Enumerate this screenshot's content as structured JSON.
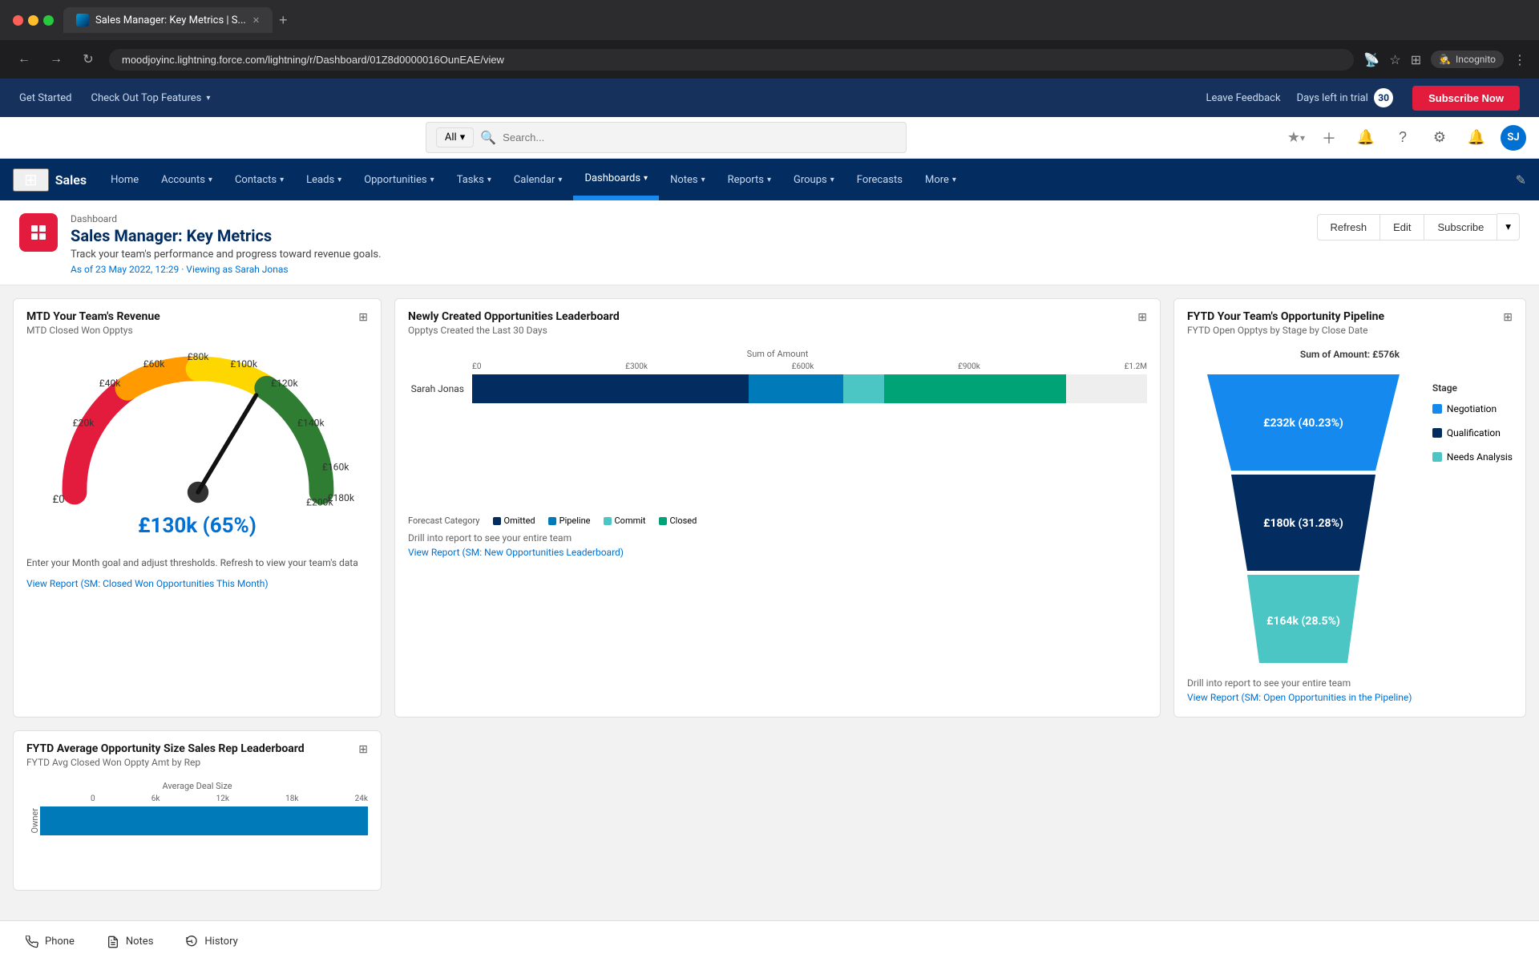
{
  "browser": {
    "tab_title": "Sales Manager: Key Metrics | S...",
    "url": "moodjoyinc.lightning.force.com/lightning/r/Dashboard/01Z8d0000016OunEAE/view",
    "new_tab_label": "+",
    "incognito_label": "Incognito"
  },
  "top_bar": {
    "get_started": "Get Started",
    "check_out_features": "Check Out Top Features",
    "leave_feedback": "Leave Feedback",
    "trial_text": "Days left in trial",
    "trial_days": "30",
    "subscribe_btn": "Subscribe Now"
  },
  "search": {
    "dropdown_label": "All",
    "placeholder": "Search..."
  },
  "sales_nav": {
    "brand": "Sales",
    "items": [
      {
        "label": "Home",
        "active": false
      },
      {
        "label": "Accounts",
        "active": false
      },
      {
        "label": "Contacts",
        "active": false
      },
      {
        "label": "Leads",
        "active": false
      },
      {
        "label": "Opportunities",
        "active": false
      },
      {
        "label": "Tasks",
        "active": false
      },
      {
        "label": "Calendar",
        "active": false
      },
      {
        "label": "Dashboards",
        "active": true
      },
      {
        "label": "Notes",
        "active": false
      },
      {
        "label": "Reports",
        "active": false
      },
      {
        "label": "Groups",
        "active": false
      },
      {
        "label": "Forecasts",
        "active": false
      },
      {
        "label": "More",
        "active": false
      }
    ]
  },
  "dashboard": {
    "breadcrumb": "Dashboard",
    "title": "Sales Manager: Key Metrics",
    "description": "Track your team's performance and progress toward revenue goals.",
    "meta": "As of 23 May 2022, 12:29 · Viewing as Sarah Jonas",
    "refresh_btn": "Refresh",
    "edit_btn": "Edit",
    "subscribe_btn": "Subscribe"
  },
  "card_mtd": {
    "title": "MTD Your Team's Revenue",
    "subtitle": "MTD Closed Won Opptys",
    "value": "£130k (65%)",
    "gauge_labels": [
      "£0",
      "£20k",
      "£40k",
      "£60k",
      "£80k",
      "£100k",
      "£120k",
      "£140k",
      "£160k",
      "£180k",
      "£200k"
    ],
    "enter_month": "Enter your Month goal and adjust thresholds. Refresh to view your team's data",
    "view_report_link": "View Report (SM: Closed Won Opportunities This Month)"
  },
  "card_leaderboard": {
    "title": "Newly Created Opportunities Leaderboard",
    "subtitle": "Opptys Created the Last 30 Days",
    "axis_title": "Sum of Amount",
    "x_labels": [
      "£0",
      "£300k",
      "£600k",
      "£900k",
      "£1.2M"
    ],
    "rows": [
      {
        "label": "Sarah Jonas",
        "segments": [
          {
            "type": "omitted",
            "pct": 40
          },
          {
            "type": "pipeline",
            "pct": 12
          },
          {
            "type": "commit",
            "pct": 5
          },
          {
            "type": "closed",
            "pct": 28
          }
        ]
      }
    ],
    "legend": [
      {
        "label": "Omitted",
        "color": "#032d60"
      },
      {
        "label": "Pipeline",
        "color": "#007ab8"
      },
      {
        "label": "Commit",
        "color": "#4bc6c4"
      },
      {
        "label": "Closed",
        "color": "#00a376"
      }
    ],
    "drill_text": "Drill into report to see your entire team",
    "view_report_link": "View Report (SM: New Opportunities Leaderboard)"
  },
  "card_pipeline": {
    "title": "FYTD Your Team's Opportunity Pipeline",
    "subtitle": "FYTD Open Opptys by Stage by Close Date",
    "sum_label": "Sum of Amount: £576k",
    "stage_label": "Stage",
    "segments": [
      {
        "label": "£232k (40.23%)",
        "color": "#1589ee",
        "legend": "Negotiation",
        "width_pct": 80
      },
      {
        "label": "£180k (31.28%)",
        "color": "#032d60",
        "legend": "Qualification",
        "width_pct": 62
      },
      {
        "label": "£164k (28.5%)",
        "color": "#4bc6c4",
        "legend": "Needs Analysis",
        "width_pct": 57
      }
    ],
    "drill_text": "Drill into report to see your entire team",
    "view_report_link": "View Report (SM: Open Opportunities in the Pipeline)"
  },
  "card_avg_size": {
    "title": "FYTD Average Opportunity Size Sales Rep Leaderboard",
    "subtitle": "FYTD Avg Closed Won Oppty Amt by Rep",
    "axis_title": "Average Deal Size",
    "x_labels": [
      "0",
      "6k",
      "12k",
      "18k",
      "24k"
    ],
    "bar_color": "#007ab8"
  },
  "bottom_bar": {
    "phone": "Phone",
    "notes": "Notes",
    "history": "History"
  }
}
